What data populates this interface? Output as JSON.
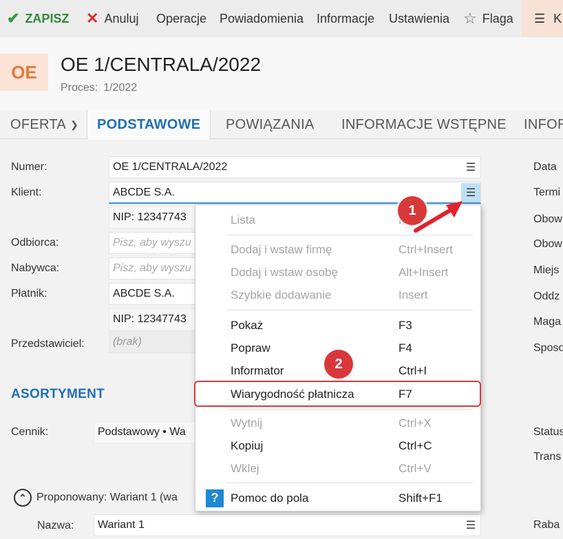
{
  "toolbar": {
    "save": "ZAPISZ",
    "cancel": "Anuluj",
    "operations": "Operacje",
    "notifications": "Powiadomienia",
    "information": "Informacje",
    "settings": "Ustawienia",
    "flag": "Flaga",
    "more": "K"
  },
  "header": {
    "badge": "OE",
    "title": "OE 1/CENTRALA/2022",
    "process_label": "Proces:",
    "process_value": "1/2022"
  },
  "tabs": [
    "OFERTA",
    "PODSTAWOWE",
    "POWIĄZANIA",
    "INFORMACJE WSTĘPNE",
    "INFOR"
  ],
  "form": {
    "numer_label": "Numer:",
    "numer_value": "OE 1/CENTRALA/2022",
    "klient_label": "Klient:",
    "klient_value": "ABCDE S.A.",
    "klient_nip": "NIP:  12347743",
    "odbiorca_label": "Odbiorca:",
    "odbiorca_placeholder": "Pisz, aby wyszu",
    "nabywca_label": "Nabywca:",
    "nabywca_placeholder": "Pisz, aby wyszu",
    "platnik_label": "Płatnik:",
    "platnik_value": "ABCDE S.A.",
    "platnik_nip": "NIP:  12347743",
    "przedstawiciel_label": "Przedstawiciel:",
    "przedstawiciel_value": "(brak)"
  },
  "right_labels": [
    "Data",
    "Termi",
    "Obow",
    "Obow",
    "Miejs",
    "Oddz",
    "Maga",
    "Sposo",
    "Status",
    "Trans",
    "Raba"
  ],
  "section": {
    "title": "ASORTYMENT",
    "cennik_label": "Cennik:",
    "cennik_value": "Podstawowy • Wa",
    "proponowany": "Proponowany: Wariant 1 (wa",
    "nazwa_label": "Nazwa:",
    "nazwa_value": "Wariant 1"
  },
  "menu": {
    "items": [
      {
        "label": "Lista",
        "key": "F"
      },
      {
        "label": "Dodaj i wstaw firmę",
        "key": "Ctrl+Insert"
      },
      {
        "label": "Dodaj i wstaw osobę",
        "key": "Alt+Insert"
      },
      {
        "label": "Szybkie dodawanie",
        "key": "Insert"
      },
      {
        "label": "Pokaż",
        "key": "F3"
      },
      {
        "label": "Popraw",
        "key": "F4"
      },
      {
        "label": "Informator",
        "key": "Ctrl+I"
      },
      {
        "label": "Wiarygodność płatnicza",
        "key": "F7"
      },
      {
        "label": "Wytnij",
        "key": "Ctrl+X"
      },
      {
        "label": "Kopiuj",
        "key": "Ctrl+C"
      },
      {
        "label": "Wklej",
        "key": "Ctrl+V"
      },
      {
        "label": "Pomoc do pola",
        "key": "Shift+F1"
      }
    ]
  },
  "markers": [
    "1",
    "2"
  ],
  "colors": {
    "accent": "#1f6fb5",
    "save_green": "#2e8b3a",
    "cancel_red": "#d9302f",
    "marker_red": "#d9383a",
    "badge_orange": "#e07a3c"
  },
  "icons": {
    "save": "check-icon",
    "cancel": "x-icon",
    "flag": "star-icon",
    "menu": "hamburger-icon",
    "help": "question-icon"
  }
}
